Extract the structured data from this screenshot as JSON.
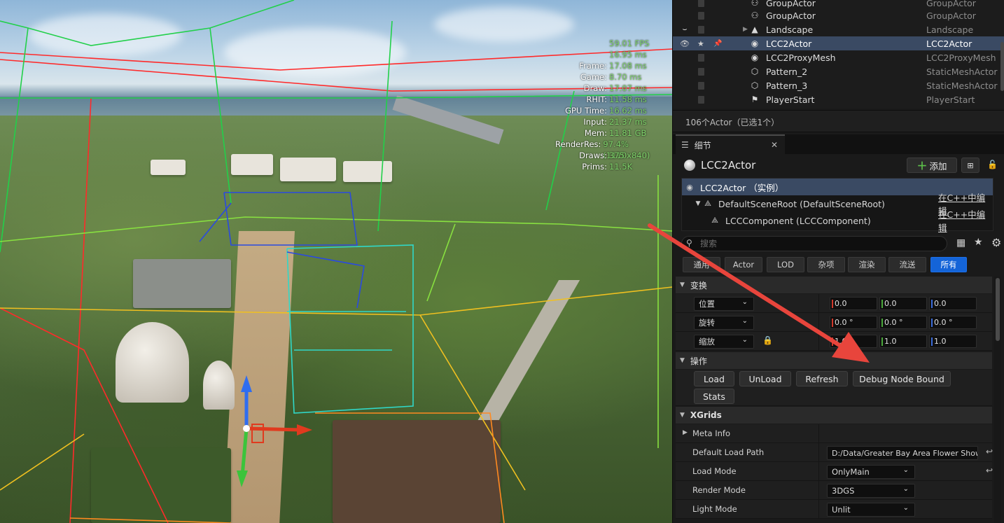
{
  "viewport": {
    "stats": [
      {
        "label": "",
        "value": "59.01 FPS"
      },
      {
        "label": "",
        "value": "16.95 ms"
      },
      {
        "label": "Frame:",
        "value": "17.08 ms"
      },
      {
        "label": "Game:",
        "value": "8.70 ms"
      },
      {
        "label": "Draw:",
        "value": "17.07 ms"
      },
      {
        "label": "RHIT:",
        "value": "11.58 ms"
      },
      {
        "label": "GPU Time:",
        "value": "16.62 ms"
      },
      {
        "label": "Input:",
        "value": "21.37 ms"
      },
      {
        "label": "Mem:",
        "value": "11.81 GB"
      },
      {
        "label": "RenderRes:",
        "value": "97.4% (1110x840)"
      },
      {
        "label": "Draws:",
        "value": "375"
      },
      {
        "label": "Prims:",
        "value": "11.5K"
      }
    ]
  },
  "outliner": {
    "rows": [
      {
        "name": "GroupActor",
        "type": "GroupActor",
        "icon": "group-actor-icon"
      },
      {
        "name": "GroupActor",
        "type": "GroupActor",
        "icon": "group-actor-icon"
      },
      {
        "name": "Landscape",
        "type": "Landscape",
        "icon": "landscape-icon"
      },
      {
        "name": "LCC2Actor",
        "type": "LCC2Actor",
        "icon": "actor-icon"
      },
      {
        "name": "LCC2ProxyMesh",
        "type": "LCC2ProxyMesh",
        "icon": "actor-icon"
      },
      {
        "name": "Pattern_2",
        "type": "StaticMeshActor",
        "icon": "static-mesh-icon"
      },
      {
        "name": "Pattern_3",
        "type": "StaticMeshActor",
        "icon": "static-mesh-icon"
      },
      {
        "name": "PlayerStart",
        "type": "PlayerStart",
        "icon": "player-start-icon"
      }
    ],
    "actor_count": "106个Actor（已选1个）"
  },
  "details": {
    "tab_label": "细节",
    "actor_title": "LCC2Actor",
    "add_label": "添加",
    "components": {
      "instance": "LCC2Actor （实例）",
      "root": "DefaultSceneRoot (DefaultSceneRoot)",
      "lcc": "LCCComponent (LCCComponent)",
      "edit_cpp": "在C++中编辑"
    },
    "search_placeholder": "搜索",
    "filter_tabs": [
      "通用",
      "Actor",
      "LOD",
      "杂项",
      "渲染",
      "流送",
      "所有"
    ],
    "sections": {
      "transform": "变换",
      "actions": "操作",
      "xgrids": "XGrids"
    },
    "transform": {
      "location_label": "位置",
      "rotation_label": "旋转",
      "scale_label": "缩放",
      "location": [
        "0.0",
        "0.0",
        "0.0"
      ],
      "rotation": [
        "0.0 °",
        "0.0 °",
        "0.0 °"
      ],
      "scale": [
        "1.0",
        "1.0",
        "1.0"
      ]
    },
    "actions": {
      "load": "Load",
      "unload": "UnLoad",
      "refresh": "Refresh",
      "debug": "Debug Node Bound",
      "stats": "Stats"
    },
    "xgrids": {
      "meta_info": "Meta Info",
      "default_load_path_label": "Default Load Path",
      "default_load_path": "D:/Data/Greater Bay Area Flower Show",
      "load_mode_label": "Load Mode",
      "load_mode": "OnlyMain",
      "render_mode_label": "Render Mode",
      "render_mode": "3DGS",
      "light_mode_label": "Light Mode",
      "light_mode": "Unlit"
    }
  },
  "colors": {
    "selection": "#3a4a63",
    "active_tab": "#1464d8",
    "annotation_arrow": "#e8453c",
    "stat_value": "#7fd36b"
  }
}
